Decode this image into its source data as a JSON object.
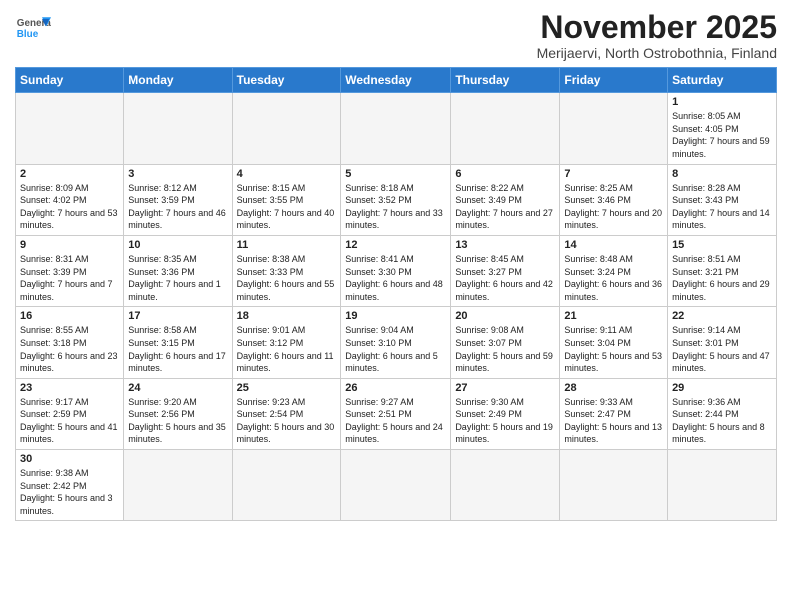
{
  "logo": {
    "text_general": "General",
    "text_blue": "Blue"
  },
  "header": {
    "month": "November 2025",
    "location": "Merijaervi, North Ostrobothnia, Finland"
  },
  "weekdays": [
    "Sunday",
    "Monday",
    "Tuesday",
    "Wednesday",
    "Thursday",
    "Friday",
    "Saturday"
  ],
  "weeks": [
    [
      {
        "day": "",
        "empty": true
      },
      {
        "day": "",
        "empty": true
      },
      {
        "day": "",
        "empty": true
      },
      {
        "day": "",
        "empty": true
      },
      {
        "day": "",
        "empty": true
      },
      {
        "day": "",
        "empty": true
      },
      {
        "day": "1",
        "sunrise": "8:05 AM",
        "sunset": "4:05 PM",
        "daylight": "7 hours and 59 minutes."
      }
    ],
    [
      {
        "day": "2",
        "sunrise": "8:09 AM",
        "sunset": "4:02 PM",
        "daylight": "7 hours and 53 minutes."
      },
      {
        "day": "3",
        "sunrise": "8:12 AM",
        "sunset": "3:59 PM",
        "daylight": "7 hours and 46 minutes."
      },
      {
        "day": "4",
        "sunrise": "8:15 AM",
        "sunset": "3:55 PM",
        "daylight": "7 hours and 40 minutes."
      },
      {
        "day": "5",
        "sunrise": "8:18 AM",
        "sunset": "3:52 PM",
        "daylight": "7 hours and 33 minutes."
      },
      {
        "day": "6",
        "sunrise": "8:22 AM",
        "sunset": "3:49 PM",
        "daylight": "7 hours and 27 minutes."
      },
      {
        "day": "7",
        "sunrise": "8:25 AM",
        "sunset": "3:46 PM",
        "daylight": "7 hours and 20 minutes."
      },
      {
        "day": "8",
        "sunrise": "8:28 AM",
        "sunset": "3:43 PM",
        "daylight": "7 hours and 14 minutes."
      }
    ],
    [
      {
        "day": "9",
        "sunrise": "8:31 AM",
        "sunset": "3:39 PM",
        "daylight": "7 hours and 7 minutes."
      },
      {
        "day": "10",
        "sunrise": "8:35 AM",
        "sunset": "3:36 PM",
        "daylight": "7 hours and 1 minute."
      },
      {
        "day": "11",
        "sunrise": "8:38 AM",
        "sunset": "3:33 PM",
        "daylight": "6 hours and 55 minutes."
      },
      {
        "day": "12",
        "sunrise": "8:41 AM",
        "sunset": "3:30 PM",
        "daylight": "6 hours and 48 minutes."
      },
      {
        "day": "13",
        "sunrise": "8:45 AM",
        "sunset": "3:27 PM",
        "daylight": "6 hours and 42 minutes."
      },
      {
        "day": "14",
        "sunrise": "8:48 AM",
        "sunset": "3:24 PM",
        "daylight": "6 hours and 36 minutes."
      },
      {
        "day": "15",
        "sunrise": "8:51 AM",
        "sunset": "3:21 PM",
        "daylight": "6 hours and 29 minutes."
      }
    ],
    [
      {
        "day": "16",
        "sunrise": "8:55 AM",
        "sunset": "3:18 PM",
        "daylight": "6 hours and 23 minutes."
      },
      {
        "day": "17",
        "sunrise": "8:58 AM",
        "sunset": "3:15 PM",
        "daylight": "6 hours and 17 minutes."
      },
      {
        "day": "18",
        "sunrise": "9:01 AM",
        "sunset": "3:12 PM",
        "daylight": "6 hours and 11 minutes."
      },
      {
        "day": "19",
        "sunrise": "9:04 AM",
        "sunset": "3:10 PM",
        "daylight": "6 hours and 5 minutes."
      },
      {
        "day": "20",
        "sunrise": "9:08 AM",
        "sunset": "3:07 PM",
        "daylight": "5 hours and 59 minutes."
      },
      {
        "day": "21",
        "sunrise": "9:11 AM",
        "sunset": "3:04 PM",
        "daylight": "5 hours and 53 minutes."
      },
      {
        "day": "22",
        "sunrise": "9:14 AM",
        "sunset": "3:01 PM",
        "daylight": "5 hours and 47 minutes."
      }
    ],
    [
      {
        "day": "23",
        "sunrise": "9:17 AM",
        "sunset": "2:59 PM",
        "daylight": "5 hours and 41 minutes."
      },
      {
        "day": "24",
        "sunrise": "9:20 AM",
        "sunset": "2:56 PM",
        "daylight": "5 hours and 35 minutes."
      },
      {
        "day": "25",
        "sunrise": "9:23 AM",
        "sunset": "2:54 PM",
        "daylight": "5 hours and 30 minutes."
      },
      {
        "day": "26",
        "sunrise": "9:27 AM",
        "sunset": "2:51 PM",
        "daylight": "5 hours and 24 minutes."
      },
      {
        "day": "27",
        "sunrise": "9:30 AM",
        "sunset": "2:49 PM",
        "daylight": "5 hours and 19 minutes."
      },
      {
        "day": "28",
        "sunrise": "9:33 AM",
        "sunset": "2:47 PM",
        "daylight": "5 hours and 13 minutes."
      },
      {
        "day": "29",
        "sunrise": "9:36 AM",
        "sunset": "2:44 PM",
        "daylight": "5 hours and 8 minutes."
      }
    ],
    [
      {
        "day": "30",
        "sunrise": "9:38 AM",
        "sunset": "2:42 PM",
        "daylight": "5 hours and 3 minutes."
      },
      {
        "day": "",
        "empty": true
      },
      {
        "day": "",
        "empty": true
      },
      {
        "day": "",
        "empty": true
      },
      {
        "day": "",
        "empty": true
      },
      {
        "day": "",
        "empty": true
      },
      {
        "day": "",
        "empty": true
      }
    ]
  ]
}
